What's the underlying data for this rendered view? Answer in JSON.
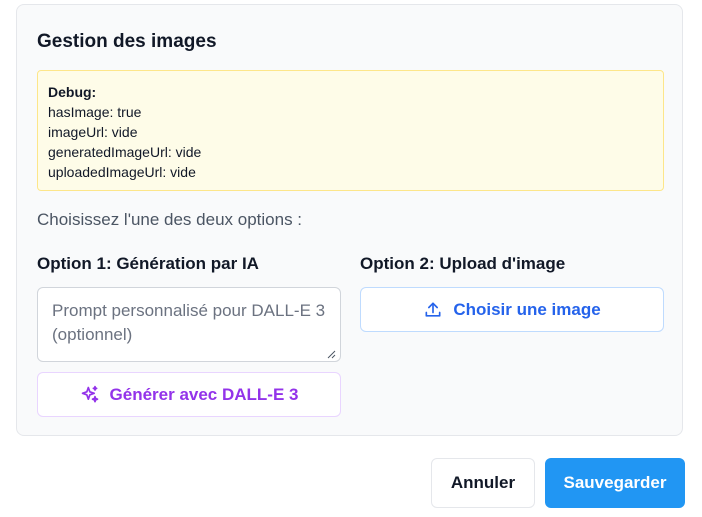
{
  "panel": {
    "title": "Gestion des images"
  },
  "debug": {
    "heading": "Debug:",
    "lines": [
      "hasImage: true",
      "imageUrl: vide",
      "generatedImageUrl: vide",
      "uploadedImageUrl: vide"
    ]
  },
  "instructions": "Choisissez l'une des deux options :",
  "option1": {
    "title": "Option 1: Génération par IA",
    "prompt_value": "",
    "prompt_placeholder": "Prompt personnalisé pour DALL-E 3 (optionnel)",
    "generate_label": "Générer avec DALL-E 3",
    "generate_icon": "sparkles-icon"
  },
  "option2": {
    "title": "Option 2: Upload d'image",
    "upload_label": "Choisir une image",
    "upload_icon": "upload-icon"
  },
  "footer": {
    "cancel_label": "Annuler",
    "save_label": "Sauvegarder"
  },
  "colors": {
    "primary": "#2196f3",
    "ai_accent": "#9333ea",
    "upload_accent": "#2563eb",
    "debug_bg": "#fefce8"
  }
}
